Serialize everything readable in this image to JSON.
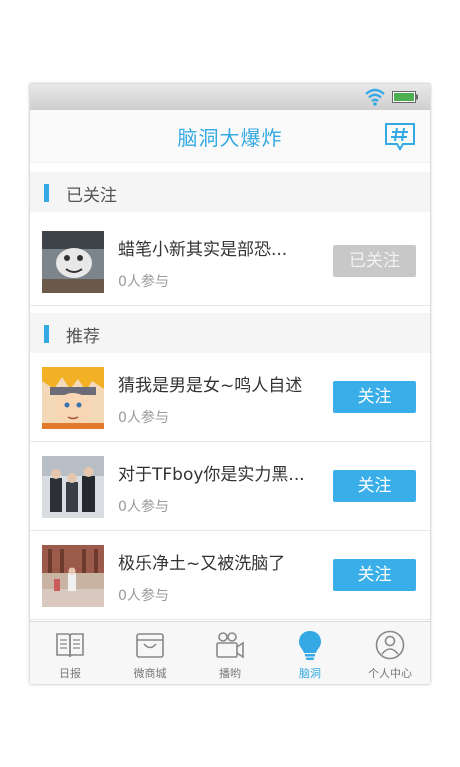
{
  "app": {
    "title": "脑洞大爆炸"
  },
  "status_bar": {
    "wifi_icon": "wifi-icon",
    "battery_icon": "battery-icon"
  },
  "followed_section": {
    "label": "已关注",
    "items": [
      {
        "title": "蜡笔小新其实是部恐...",
        "participants": "0人参与",
        "button": "已关注"
      }
    ]
  },
  "recommended_section": {
    "label": "推荐",
    "items": [
      {
        "title": "猜我是男是女~鸣人自述",
        "participants": "0人参与",
        "button": "关注"
      },
      {
        "title": "对于TFboy你是实力黑...",
        "participants": "0人参与",
        "button": "关注"
      },
      {
        "title": "极乐净土~又被洗脑了",
        "participants": "0人参与",
        "button": "关注"
      }
    ]
  },
  "tabbar": {
    "tabs": [
      {
        "label": "日报",
        "icon": "book-icon"
      },
      {
        "label": "微商城",
        "icon": "shop-bag-icon"
      },
      {
        "label": "播哟",
        "icon": "video-camera-icon"
      },
      {
        "label": "脑洞",
        "icon": "lightbulb-icon",
        "active": true
      },
      {
        "label": "个人中心",
        "icon": "user-icon"
      }
    ]
  },
  "colors": {
    "accent": "#34a9e3",
    "button": "#39aee8",
    "followed_button": "#c8c8c8"
  }
}
